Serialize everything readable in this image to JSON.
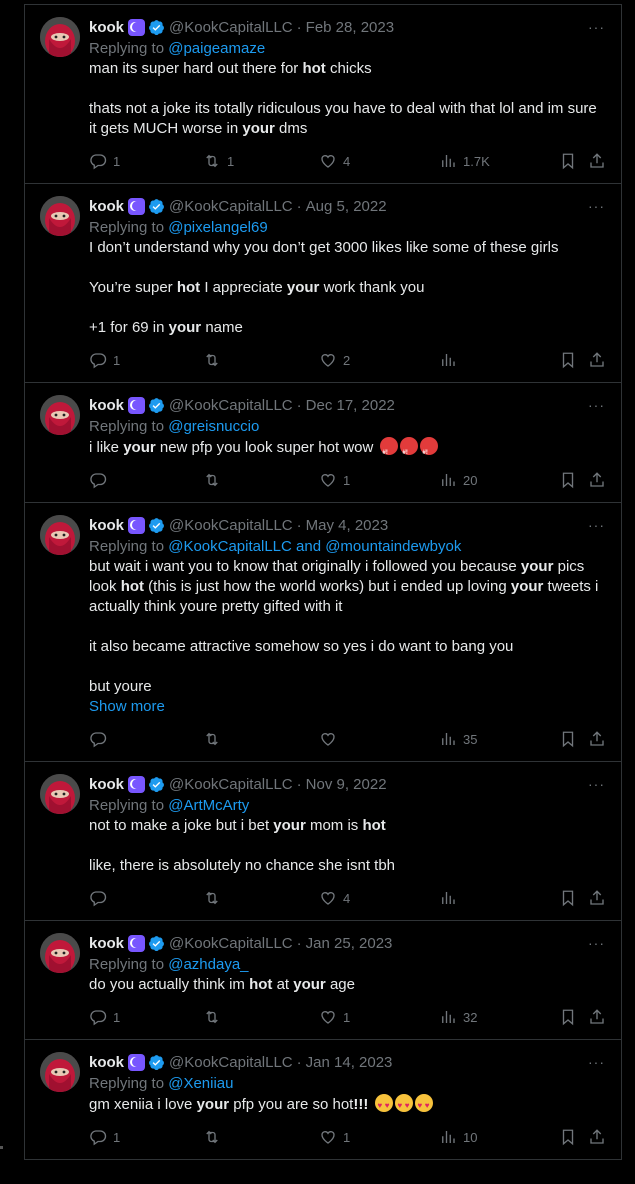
{
  "author": {
    "name": "kook",
    "handle": "@KookCapitalLLC",
    "dot": "·",
    "replying_prefix": "Replying to "
  },
  "icons": [
    "reply-icon",
    "retweet-icon",
    "like-icon",
    "views-icon",
    "bookmark-icon",
    "share-icon",
    "more-icon",
    "verified-icon",
    "moon-badge-icon"
  ],
  "colors": {
    "accent": "#1d9bf0",
    "muted": "#71767b",
    "text": "#e7e9ea",
    "badge": "#7856ff",
    "border": "#2f3336"
  },
  "more_label": "···",
  "show_more_label": "Show more",
  "tweets": [
    {
      "date": "Feb 28, 2023",
      "replying_to": "@paigeamaze",
      "body": [
        "man its super hard out there for ",
        {
          "b": "hot"
        },
        " chicks\n\nthats not a joke its totally ridiculous you have to deal with that lol and im sure it gets MUCH worse in ",
        {
          "b": "your"
        },
        " dms"
      ],
      "replies": "1",
      "retweets": "1",
      "likes": "4",
      "views": "1.7K"
    },
    {
      "date": "Aug 5, 2022",
      "replying_to": "@pixelangel69",
      "body": [
        "I don’t understand why you don’t get 3000 likes like some of these girls\n\nYou’re super ",
        {
          "b": "hot"
        },
        " I appreciate ",
        {
          "b": "your"
        },
        " work thank you\n\n+1 for 69 in ",
        {
          "b": "your"
        },
        " name"
      ],
      "replies": "1",
      "retweets": "",
      "likes": "2",
      "views": ""
    },
    {
      "date": "Dec 17, 2022",
      "replying_to": "@greisnuccio",
      "body": [
        "i like ",
        {
          "b": "your"
        },
        " new pfp you look super hot wow "
      ],
      "emoji": [
        "swear",
        "swear",
        "swear"
      ],
      "replies": "",
      "retweets": "",
      "likes": "1",
      "views": "20"
    },
    {
      "date": "May 4, 2023",
      "replying_to": "@KookCapitalLLC and @mountaindewbyok",
      "body": [
        "but wait i want you to know that originally i followed you because ",
        {
          "b": "your"
        },
        " pics look ",
        {
          "b": "hot"
        },
        " (this is just how the world works) but i ended up loving ",
        {
          "b": "your"
        },
        " tweets i actually think youre pretty gifted with it\n\nit also became attractive somehow so yes i do want to bang you\n\nbut youre"
      ],
      "show_more": true,
      "replies": "",
      "retweets": "",
      "likes": "",
      "views": "35"
    },
    {
      "date": "Nov 9, 2022",
      "replying_to": "@ArtMcArty",
      "body": [
        "not to make a joke but i bet ",
        {
          "b": "your"
        },
        " mom is ",
        {
          "b": "hot"
        },
        "\n\nlike, there is absolutely no chance she isnt tbh"
      ],
      "replies": "",
      "retweets": "",
      "likes": "4",
      "views": ""
    },
    {
      "date": "Jan 25, 2023",
      "replying_to": "@azhdaya_",
      "body": [
        "do you actually think im ",
        {
          "b": "hot"
        },
        " at ",
        {
          "b": "your"
        },
        " age"
      ],
      "replies": "1",
      "retweets": "",
      "likes": "1",
      "views": "32"
    },
    {
      "date": "Jan 14, 2023",
      "replying_to": "@Xeniiau",
      "body": [
        "gm xeniia i love ",
        {
          "b": "your"
        },
        " pfp you are so hot",
        {
          "b": "!!!"
        },
        " "
      ],
      "emoji": [
        "heart",
        "heart",
        "heart"
      ],
      "replies": "1",
      "retweets": "",
      "likes": "1",
      "views": "10"
    }
  ]
}
